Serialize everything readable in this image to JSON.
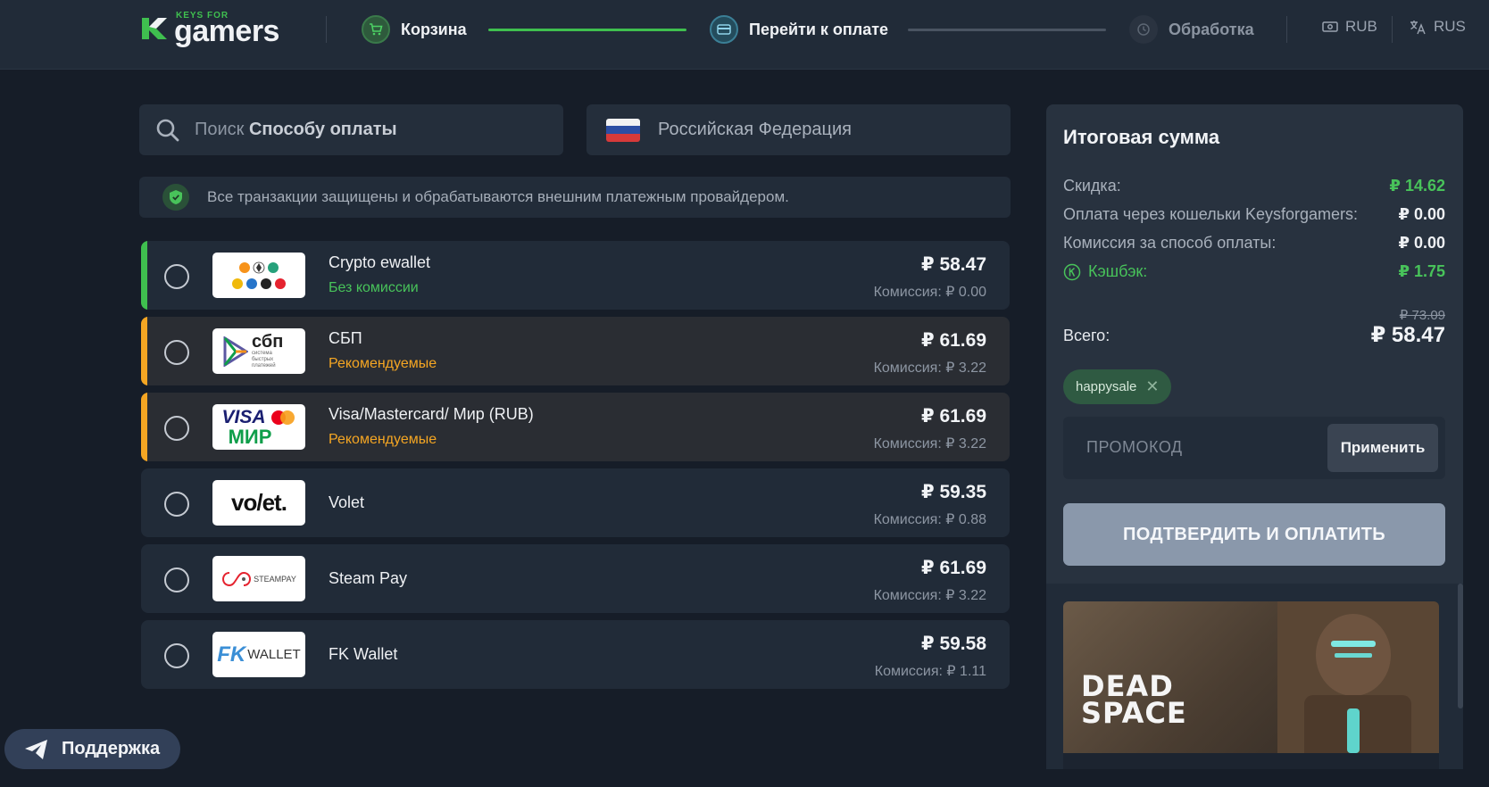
{
  "brand": {
    "small": "KEYS FOR",
    "big": "gamers"
  },
  "steps": [
    {
      "label": "Корзина"
    },
    {
      "label": "Перейти к оплате"
    },
    {
      "label": "Обработка"
    }
  ],
  "header": {
    "currency": "RUB",
    "language": "RUS"
  },
  "search": {
    "prefix": "Поиск",
    "bold": "Способу оплаты"
  },
  "country": {
    "name": "Российская Федерация"
  },
  "secure_notice": "Все транзакции защищены и обрабатываются внешним платежным провайдером.",
  "methods": [
    {
      "name": "Crypto ewallet",
      "tag": "Без комиссии",
      "price": "₽ 58.47",
      "fee": "Комиссия: ₽ 0.00"
    },
    {
      "name": "СБП",
      "tag": "Рекомендуемые",
      "price": "₽ 61.69",
      "fee": "Комиссия: ₽ 3.22",
      "logo_text": "сбп",
      "logo_sub": "система быстрых платежей"
    },
    {
      "name": "Visa/Mastercard/ Мир (RUB)",
      "tag": "Рекомендуемые",
      "price": "₽ 61.69",
      "fee": "Комиссия: ₽ 3.22",
      "logo_text": "VISA",
      "logo_sub": "МИР"
    },
    {
      "name": "Volet",
      "price": "₽ 59.35",
      "fee": "Комиссия: ₽ 0.88",
      "logo_text": "vo/et."
    },
    {
      "name": "Steam Pay",
      "price": "₽ 61.69",
      "fee": "Комиссия: ₽ 3.22",
      "logo_text": "STEAMPAY"
    },
    {
      "name": "FK Wallet",
      "price": "₽ 59.58",
      "fee": "Комиссия: ₽ 1.11",
      "logo_text": "FK",
      "logo_sub": "WALLET"
    }
  ],
  "summary": {
    "title": "Итоговая сумма",
    "rows": [
      {
        "label": "Скидка:",
        "value": "₽ 14.62"
      },
      {
        "label": "Оплата через кошельки Keysforgamers:",
        "value": "₽ 0.00"
      },
      {
        "label": "Комиссия за способ оплаты:",
        "value": "₽ 0.00"
      },
      {
        "label": "Кэшбэк:",
        "value": "₽ 1.75"
      }
    ],
    "old_total": "₽ 73.09",
    "total_label": "Всего:",
    "total": "₽ 58.47",
    "promo_chip": "happysale",
    "promo_placeholder": "ПРОМОКОД",
    "apply_label": "Применить",
    "confirm_label": "ПОДТВЕРДИТЬ И ОПЛАТИТЬ"
  },
  "game": {
    "title_line1": "DEAD",
    "title_line2": "SPACE"
  },
  "support_label": "Поддержка",
  "colors": {
    "accent_green": "#48c35a",
    "recommended_orange": "#f5a623",
    "background": "#161d28",
    "panel": "#212b38"
  }
}
